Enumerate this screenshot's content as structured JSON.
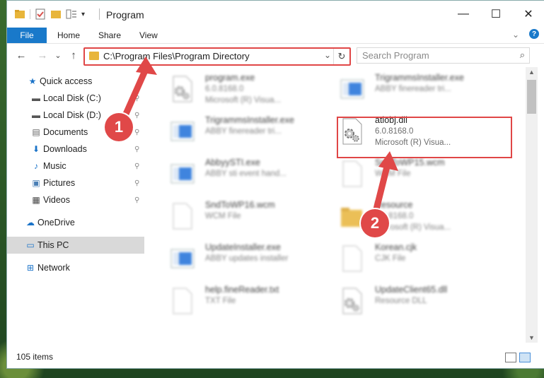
{
  "window": {
    "title": "Program",
    "controls": {
      "minimize": "—",
      "maximize": "☐",
      "close": "✕"
    }
  },
  "ribbon": {
    "tabs": [
      {
        "label": "File",
        "active": true
      },
      {
        "label": "Home"
      },
      {
        "label": "Share"
      },
      {
        "label": "View"
      }
    ],
    "help": "?",
    "chevron": "⌄"
  },
  "navigation": {
    "back": "←",
    "forward": "→",
    "recent": "⌄",
    "up": "↑",
    "address": "C:\\Program Files\\Program Directory",
    "refresh": "↻",
    "dropdown": "⌄",
    "search_placeholder": "Search Program",
    "search_icon": "⌕"
  },
  "sidebar": {
    "items": [
      {
        "label": "Quick access",
        "icon": "star-icon",
        "glyph": "★",
        "color": "#1a73c8"
      },
      {
        "label": "Local Disk (C:)",
        "icon": "drive-icon",
        "glyph": "▬",
        "color": "#555555",
        "pinned": true
      },
      {
        "label": "Local Disk (D:)",
        "icon": "drive-icon",
        "glyph": "▬",
        "color": "#555555",
        "pinned": true
      },
      {
        "label": "Documents",
        "icon": "documents-icon",
        "glyph": "▤",
        "color": "#666666",
        "pinned": true
      },
      {
        "label": "Downloads",
        "icon": "download-icon",
        "glyph": "⬇",
        "color": "#1a73c8",
        "pinned": true
      },
      {
        "label": "Music",
        "icon": "music-icon",
        "glyph": "♪",
        "color": "#1a73c8",
        "pinned": true
      },
      {
        "label": "Pictures",
        "icon": "pictures-icon",
        "glyph": "▣",
        "color": "#4a7fb5",
        "pinned": true
      },
      {
        "label": "Videos",
        "icon": "videos-icon",
        "glyph": "▦",
        "color": "#444444",
        "pinned": true
      },
      {
        "label": "OneDrive",
        "icon": "cloud-icon",
        "glyph": "☁",
        "color": "#1a73c8"
      },
      {
        "label": "This PC",
        "icon": "computer-icon",
        "glyph": "▭",
        "color": "#1a73c8",
        "selected": true
      },
      {
        "label": "Network",
        "icon": "network-icon",
        "glyph": "⊞",
        "color": "#1a73c8"
      }
    ],
    "pin_glyph": "📌"
  },
  "files": [
    {
      "name": "program.exe",
      "line1": "6.0.8168.0",
      "line2": "Microsoft (R) Visua...",
      "kind": "exe-gear",
      "blurred": true
    },
    {
      "name": "TrigrammsInstaller.exe",
      "line1": "ABBY finereader tri...",
      "line2": "",
      "kind": "installer",
      "blurred": true
    },
    {
      "name": "TrigrammsInstaller.exe",
      "line1": "ABBY finereader tri...",
      "line2": "",
      "kind": "installer",
      "blurred": true
    },
    {
      "name": "atlobj.dll",
      "line1": "6.0.8168.0",
      "line2": "Microsoft (R) Visua...",
      "kind": "dll",
      "blurred": false
    },
    {
      "name": "AbbyySTI.exe",
      "line1": "ABBY sti event hand...",
      "line2": "",
      "kind": "installer",
      "blurred": true
    },
    {
      "name": "SndToWP15.wcm",
      "line1": "WCM File",
      "line2": "",
      "kind": "blank",
      "blurred": true
    },
    {
      "name": "SndToWP16.wcm",
      "line1": "WCM File",
      "line2": "",
      "kind": "blank",
      "blurred": true
    },
    {
      "name": "Resource",
      "line1": "6.0.8168.0",
      "line2": "Microsoft (R) Visua...",
      "kind": "folder",
      "blurred": true
    },
    {
      "name": "UpdateInstaller.exe",
      "line1": "ABBY updates installer",
      "line2": "",
      "kind": "installer",
      "blurred": true
    },
    {
      "name": "Korean.cjk",
      "line1": "CJK File",
      "line2": "",
      "kind": "blank",
      "blurred": true
    },
    {
      "name": "help.fineReader.txt",
      "line1": "TXT File",
      "line2": "",
      "kind": "blank",
      "blurred": true
    },
    {
      "name": "UpdateClient65.dll",
      "line1": "Resource DLL",
      "line2": "",
      "kind": "dll",
      "blurred": true
    }
  ],
  "status": {
    "count": "105 items"
  },
  "markers": [
    {
      "label": "1"
    },
    {
      "label": "2"
    }
  ],
  "colors": {
    "accent": "#1979ca",
    "highlight": "#e04646",
    "folder": "#e8b53a"
  }
}
